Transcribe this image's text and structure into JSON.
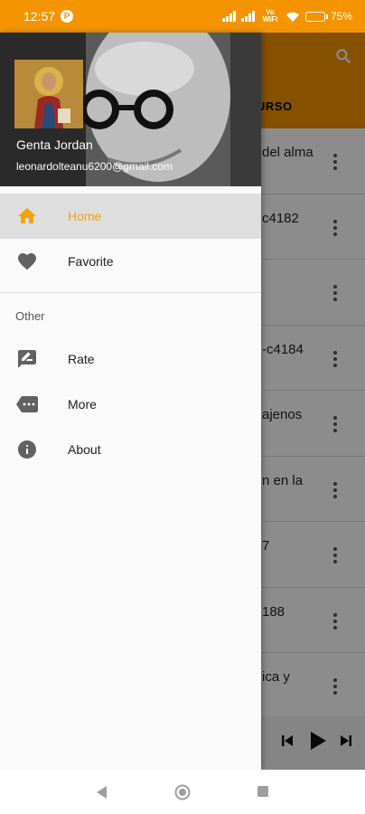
{
  "status_bar": {
    "time": "12:57",
    "notification_badge": "P",
    "network": "Vo WiFi",
    "battery_percent": "75%",
    "battery_level": 0.75
  },
  "background_app": {
    "tab_label": "URSO",
    "rows": [
      "del alma",
      "c4182",
      "",
      "-c4184",
      "ajenos",
      "n en la",
      "7",
      "188",
      "ica y"
    ]
  },
  "drawer": {
    "header": {
      "name": "Genta Jordan",
      "email": "leonardolteanu6200@gmail.com"
    },
    "items": [
      {
        "label": "Home",
        "icon": "home-icon",
        "active": true
      },
      {
        "label": "Favorite",
        "icon": "heart-icon",
        "active": false
      }
    ],
    "section_title": "Other",
    "other_items": [
      {
        "label": "Rate",
        "icon": "rate-review-icon"
      },
      {
        "label": "More",
        "icon": "more-label-icon"
      },
      {
        "label": "About",
        "icon": "info-icon"
      }
    ]
  },
  "colors": {
    "accent": "#f39400",
    "active_text": "#f4a400"
  }
}
